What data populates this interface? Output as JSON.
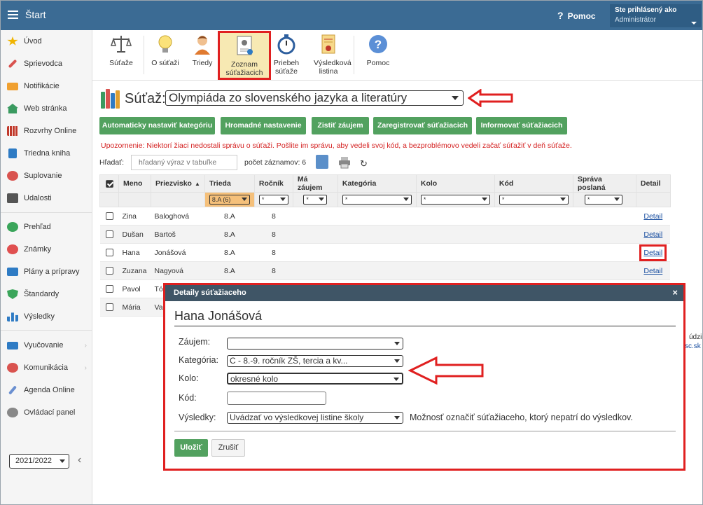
{
  "topbar": {
    "title": "Štart",
    "help_label": "Pomoc",
    "user_line1": "Ste prihlásený ako",
    "user_line2": "Administrátor"
  },
  "sidebar": {
    "items": [
      {
        "label": "Úvod",
        "icon": "star-icon",
        "color": "#f0b400"
      },
      {
        "label": "Sprievodca",
        "icon": "wand-icon",
        "color": "#d9534f"
      },
      {
        "label": "Notifikácie",
        "icon": "envelope-icon",
        "color": "#f0a030"
      },
      {
        "label": "Web stránka",
        "icon": "home-icon",
        "color": "#3a9a60"
      },
      {
        "label": "Rozvrhy Online",
        "icon": "calendar-grid-icon",
        "color": "#c0392b"
      },
      {
        "label": "Triedna kniha",
        "icon": "book-icon",
        "color": "#2e7bc4"
      },
      {
        "label": "Suplovanie",
        "icon": "user-swap-icon",
        "color": "#d9534f"
      },
      {
        "label": "Udalosti",
        "icon": "calendar-icon",
        "color": "#555555"
      },
      {
        "label": "Prehľad",
        "icon": "check-circle-icon",
        "color": "#3aa55a"
      },
      {
        "label": "Známky",
        "icon": "grade-icon",
        "color": "#e05050"
      },
      {
        "label": "Plány a prípravy",
        "icon": "briefcase-icon",
        "color": "#2e7bc4"
      },
      {
        "label": "Štandardy",
        "icon": "shield-check-icon",
        "color": "#3aa55a"
      },
      {
        "label": "Výsledky",
        "icon": "bar-chart-icon",
        "color": "#2e7bc4"
      },
      {
        "label": "Vyučovanie",
        "icon": "open-book-icon",
        "color": "#2e7bc4"
      },
      {
        "label": "Komunikácia",
        "icon": "chat-icon",
        "color": "#d9534f"
      },
      {
        "label": "Agenda Online",
        "icon": "pen-icon",
        "color": "#6a8fd0"
      },
      {
        "label": "Ovládací panel",
        "icon": "gear-icon",
        "color": "#888888"
      }
    ],
    "year": "2021/2022"
  },
  "toolbar": {
    "items": [
      "Súťaže",
      "O súťaži",
      "Triedy",
      "Zoznam súťažiacich",
      "Priebeh súťaže",
      "Výsledková listina",
      "Pomoc"
    ]
  },
  "contest": {
    "label": "Súťaž:",
    "selected": "Olympiáda zo slovenského jazyka a literatúry"
  },
  "actions": [
    "Automaticky nastaviť kategóriu",
    "Hromadné nastavenie",
    "Zistiť záujem",
    "Zaregistrovať súťažiacich",
    "Informovať súťažiacich"
  ],
  "warning": "Upozornenie: Niektorí žiaci nedostali správu o súťaži. Pošlite im správu, aby vedeli svoj kód, a bezproblémovo vedeli začať súťažiť v deň súťaže.",
  "search": {
    "label": "Hľadať:",
    "placeholder": "hľadaný výraz v tabuľke",
    "count": "počet záznamov: 6"
  },
  "table": {
    "headers": [
      "Meno",
      "Priezvisko",
      "Trieda",
      "Ročník",
      "Má záujem",
      "Kategória",
      "Kolo",
      "Kód",
      "Správa poslaná",
      "Detail"
    ],
    "filter_class": "8.A (6)",
    "filter_any": "*",
    "rows": [
      {
        "first": "Zina",
        "last": "Baloghová",
        "class": "8.A",
        "grade": "8",
        "detail": "Detail"
      },
      {
        "first": "Dušan",
        "last": "Bartoš",
        "class": "8.A",
        "grade": "8",
        "detail": "Detail"
      },
      {
        "first": "Hana",
        "last": "Jonášová",
        "class": "8.A",
        "grade": "8",
        "detail": "Detail"
      },
      {
        "first": "Zuzana",
        "last": "Nagyová",
        "class": "8.A",
        "grade": "8",
        "detail": "Detail"
      },
      {
        "first": "Pavol",
        "last": "Tó",
        "class": "",
        "grade": "",
        "detail": ""
      },
      {
        "first": "Mária",
        "last": "Va",
        "class": "",
        "grade": "",
        "detail": ""
      }
    ]
  },
  "side_fragments": {
    "a": "údzi",
    "b": "sc.sk"
  },
  "dialog": {
    "title": "Detaily súťažiaceho",
    "name": "Hana Jonášová",
    "labels": {
      "interest": "Záujem:",
      "category": "Kategória:",
      "round": "Kolo:",
      "code": "Kód:",
      "results": "Výsledky:"
    },
    "values": {
      "interest": "",
      "category": "C - 8.-9. ročník ZŠ, tercia a kv...",
      "round": "okresné kolo",
      "code": "",
      "results": "Uvádzať vo výsledkovej listine školy"
    },
    "hint": "Možnosť označiť súťažiaceho, ktorý nepatrí do výsledkov.",
    "save": "Uložiť",
    "cancel": "Zrušiť"
  },
  "colors": {
    "accent_green": "#52a15f",
    "highlight_red": "#e02020",
    "topbar": "#3b6b94"
  }
}
